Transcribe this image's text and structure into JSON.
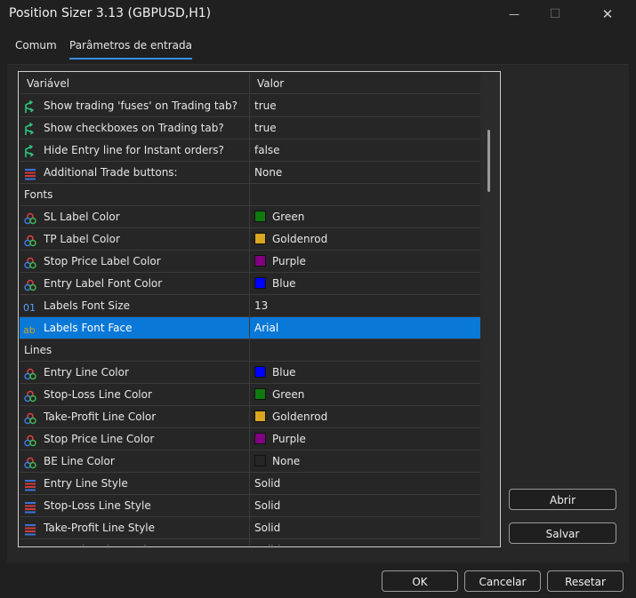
{
  "window": {
    "title": "Position Sizer 3.13 (GBPUSD,H1)",
    "minimize_glyph": "—",
    "maximize_glyph": "☐",
    "close_glyph": "✕"
  },
  "tabs": [
    {
      "label": "Comum",
      "active": false
    },
    {
      "label": "Parâmetros de entrada",
      "active": true
    }
  ],
  "grid": {
    "columns": [
      "Variável",
      "Valor"
    ],
    "rows": [
      {
        "type": "param",
        "icon": "arrow-icon",
        "name": "Show trading 'fuses' on Trading tab?",
        "value": "true"
      },
      {
        "type": "param",
        "icon": "arrow-icon",
        "name": "Show checkboxes on Trading tab?",
        "value": "true"
      },
      {
        "type": "param",
        "icon": "arrow-icon",
        "name": "Hide Entry line for Instant orders?",
        "value": "false"
      },
      {
        "type": "param",
        "icon": "enum-icon",
        "name": "Additional Trade buttons:",
        "value": "None"
      },
      {
        "type": "category",
        "name": "Fonts"
      },
      {
        "type": "param",
        "icon": "color-icon",
        "name": "SL Label Color",
        "value": "Green",
        "swatch": "#0f7a0f"
      },
      {
        "type": "param",
        "icon": "color-icon",
        "name": "TP Label Color",
        "value": "Goldenrod",
        "swatch": "#daa520"
      },
      {
        "type": "param",
        "icon": "color-icon",
        "name": "Stop Price Label Color",
        "value": "Purple",
        "swatch": "#800080"
      },
      {
        "type": "param",
        "icon": "color-icon",
        "name": "Entry Label Font Color",
        "value": "Blue",
        "swatch": "#0000ff"
      },
      {
        "type": "param",
        "icon": "int-icon",
        "name": "Labels Font Size",
        "value": "13"
      },
      {
        "type": "param",
        "icon": "string-icon",
        "name": "Labels Font Face",
        "value": "Arial",
        "selected": true
      },
      {
        "type": "category",
        "name": "Lines"
      },
      {
        "type": "param",
        "icon": "color-icon",
        "name": "Entry Line Color",
        "value": "Blue",
        "swatch": "#0000ff"
      },
      {
        "type": "param",
        "icon": "color-icon",
        "name": "Stop-Loss Line Color",
        "value": "Green",
        "swatch": "#0f7a0f"
      },
      {
        "type": "param",
        "icon": "color-icon",
        "name": "Take-Profit Line Color",
        "value": "Goldenrod",
        "swatch": "#daa520"
      },
      {
        "type": "param",
        "icon": "color-icon",
        "name": "Stop Price Line Color",
        "value": "Purple",
        "swatch": "#800080"
      },
      {
        "type": "param",
        "icon": "color-icon",
        "name": "BE Line Color",
        "value": "None",
        "swatch": "#262626"
      },
      {
        "type": "param",
        "icon": "enum-icon",
        "name": "Entry Line Style",
        "value": "Solid"
      },
      {
        "type": "param",
        "icon": "enum-icon",
        "name": "Stop-Loss Line Style",
        "value": "Solid"
      },
      {
        "type": "param",
        "icon": "enum-icon",
        "name": "Take-Profit Line Style",
        "value": "Solid"
      },
      {
        "type": "param",
        "icon": "enum-icon",
        "name": "Stop Price Line Style",
        "value": "Solid"
      }
    ]
  },
  "side_buttons": {
    "load": "Abrir",
    "save": "Salvar"
  },
  "footer_buttons": {
    "ok": "OK",
    "cancel": "Cancelar",
    "reset": "Resetar"
  },
  "icon_colors": {
    "arrow": "#2ec27e",
    "int": "#5aa0ff",
    "string": "#c9a227",
    "selection": "#0a78d7"
  }
}
